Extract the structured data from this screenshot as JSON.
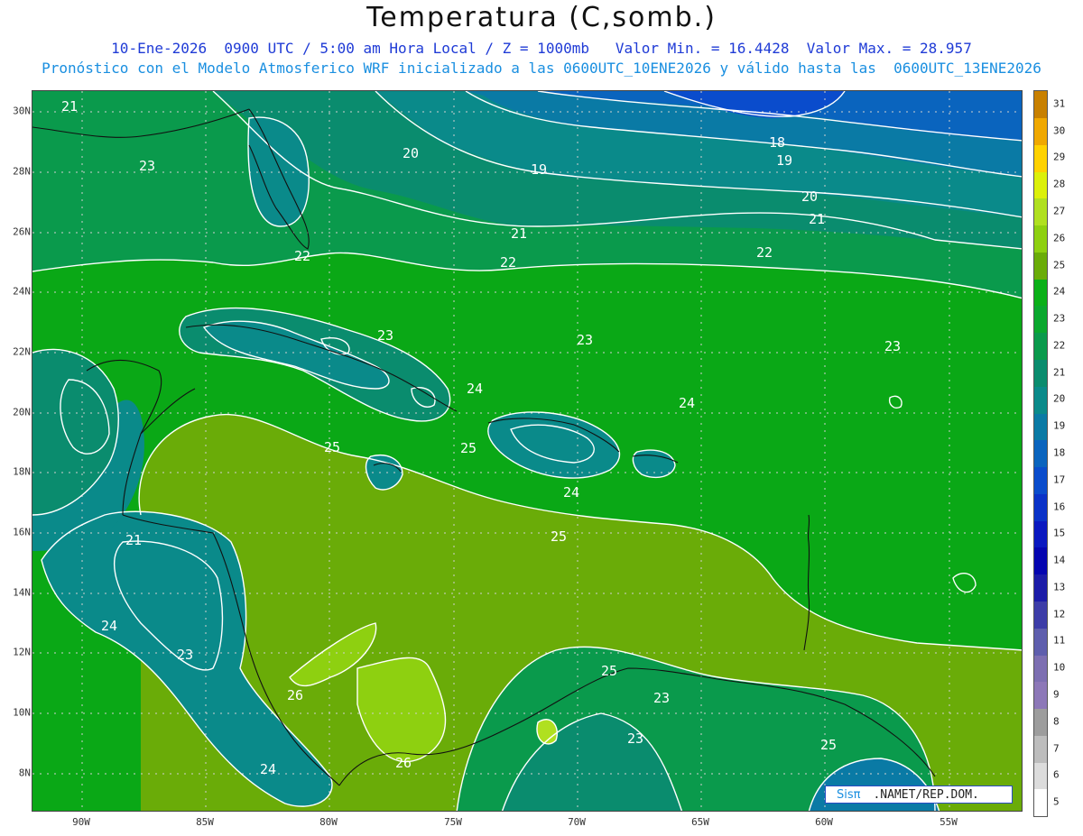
{
  "header": {
    "title": "Temperatura (C,somb.)",
    "subtitle1": "10-Ene-2026  0900 UTC / 5:00 am Hora Local / Z = 1000mb   Valor Min. = 16.4428  Valor Max. = 28.957",
    "subtitle2": "Pronóstico con el Modelo Atmosferico WRF inicializado a las 0600UTC_10ENE2026 y válido hasta las  0600UTC_13ENE2026"
  },
  "map": {
    "lon_range": [
      -92,
      -52
    ],
    "lat_range": [
      6.8,
      30.8
    ],
    "lat_ticks": [
      "8N",
      "10N",
      "12N",
      "14N",
      "16N",
      "18N",
      "20N",
      "22N",
      "24N",
      "26N",
      "28N",
      "30N"
    ],
    "lon_ticks": [
      "90W",
      "85W",
      "80W",
      "75W",
      "70W",
      "65W",
      "60W",
      "55W"
    ],
    "contour_labels": [
      "21",
      "23",
      "20",
      "19",
      "18",
      "19",
      "20",
      "21",
      "21",
      "22",
      "22",
      "22",
      "23",
      "23",
      "23",
      "24",
      "24",
      "25",
      "25",
      "24",
      "25",
      "21",
      "24",
      "23",
      "26",
      "25",
      "23",
      "23",
      "26",
      "24",
      "25"
    ]
  },
  "colorbar": {
    "levels": [
      "5",
      "6",
      "7",
      "8",
      "9",
      "10",
      "11",
      "12",
      "13",
      "14",
      "15",
      "16",
      "17",
      "18",
      "19",
      "20",
      "21",
      "22",
      "23",
      "24",
      "25",
      "26",
      "27",
      "28",
      "29",
      "30",
      "31"
    ],
    "colors": [
      "#ffffff",
      "#dcdcdc",
      "#bdbdbd",
      "#9d9d9d",
      "#8d78b8",
      "#7d6fb2",
      "#5e5ead",
      "#3d3da8",
      "#1c1ca8",
      "#0505b0",
      "#0a18c0",
      "#0a32c8",
      "#0a4ccc",
      "#0a64be",
      "#0a7aa5",
      "#0a8a8a",
      "#0a8c6e",
      "#0a9a4c",
      "#0aa82e",
      "#0ab018",
      "#6aac08",
      "#8ed010",
      "#b0e020",
      "#dcf00a",
      "#ffd200",
      "#f0a800",
      "#c88000"
    ]
  },
  "logo": {
    "brand": "Sisπ",
    "org": ".NAMET/REP.DOM."
  }
}
